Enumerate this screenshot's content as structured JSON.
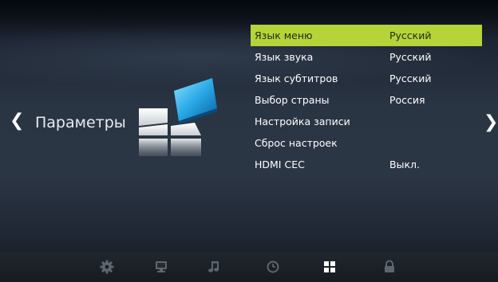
{
  "screen": {
    "title": "Параметры",
    "nav_left": "❮",
    "nav_right": "❯"
  },
  "menu": {
    "items": [
      {
        "label": "Язык меню",
        "value": "Русский",
        "selected": true
      },
      {
        "label": "Язык звука",
        "value": "Русский"
      },
      {
        "label": "Язык субтитров",
        "value": "Русский"
      },
      {
        "label": "Выбор страны",
        "value": "Россия"
      },
      {
        "label": "Настройка записи",
        "value": ""
      },
      {
        "label": "Сброс настроек",
        "value": ""
      },
      {
        "label": "HDMI CEC",
        "value": "Выкл."
      }
    ]
  },
  "bottom_tabs": [
    {
      "icon": "gear-icon",
      "active": false
    },
    {
      "icon": "monitor-icon",
      "active": false
    },
    {
      "icon": "music-note-icon",
      "active": false
    },
    {
      "icon": "clock-icon",
      "active": false
    },
    {
      "icon": "options-grid-icon",
      "active": true
    },
    {
      "icon": "lock-icon",
      "active": false
    }
  ],
  "colors": {
    "highlight": "#b6d33a",
    "inactive_icon": "#5d6670",
    "active_icon": "#ffffff",
    "text": "#ffffff"
  }
}
